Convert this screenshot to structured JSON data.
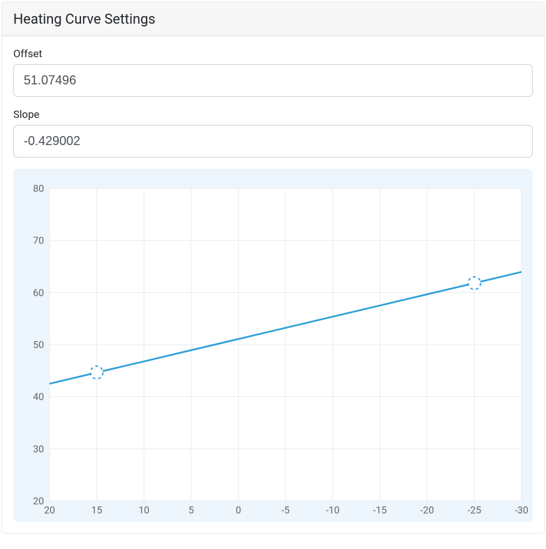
{
  "header": {
    "title": "Heating Curve Settings"
  },
  "form": {
    "offset": {
      "label": "Offset",
      "value": "51.07496"
    },
    "slope": {
      "label": "Slope",
      "value": "-0.429002"
    }
  },
  "chart_data": {
    "type": "line",
    "x_ticks": [
      20,
      15,
      10,
      5,
      0,
      -5,
      -10,
      -15,
      -20,
      -25,
      -30
    ],
    "y_ticks": [
      20,
      30,
      40,
      50,
      60,
      70,
      80
    ],
    "xlim": [
      20,
      -30
    ],
    "ylim": [
      20,
      80
    ],
    "series": [
      {
        "name": "heating-curve",
        "x": [
          20,
          15,
          10,
          5,
          0,
          -5,
          -10,
          -15,
          -20,
          -25,
          -30
        ],
        "y": [
          42.49,
          44.64,
          46.78,
          48.93,
          51.07,
          53.22,
          55.37,
          57.51,
          59.66,
          61.8,
          63.95
        ]
      }
    ],
    "handles": [
      {
        "x": 15,
        "y": 44.64
      },
      {
        "x": -25,
        "y": 61.8
      }
    ],
    "colors": {
      "line": "#2e9fd9",
      "grid": "#e9ecef",
      "plot_bg": "#ffffff",
      "outer_bg": "#edf5fd",
      "axis_text": "#666666"
    },
    "title": "",
    "xlabel": "",
    "ylabel": ""
  }
}
